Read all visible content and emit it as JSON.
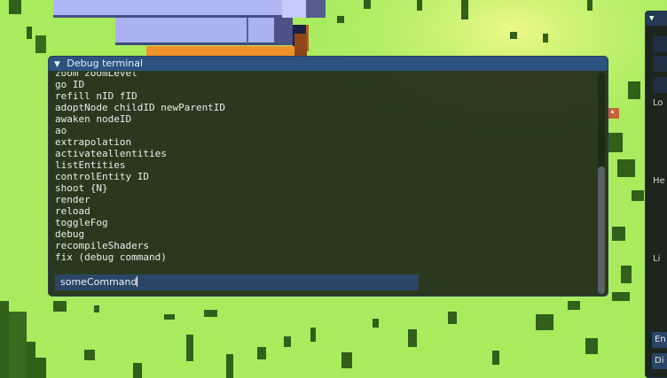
{
  "terminal": {
    "title": "Debug terminal",
    "lines": [
      "zoom zoomLevel",
      "go ID",
      "refill nID fID",
      "adoptNode childID newParentID",
      "awaken nodeID",
      "ao",
      "extrapolation",
      "activateallentities",
      "listEntities",
      "controlEntity ID",
      "shoot {N}",
      "render",
      "reload",
      "toggleFog",
      "debug",
      "recompileShaders",
      "fix (debug command)"
    ],
    "input_value": "someCommand"
  },
  "side_window": {
    "labels": [
      "Lo",
      "He",
      "Li"
    ],
    "buttons": [
      "En",
      "Di"
    ]
  },
  "colors": {
    "grass": "#a8ec5e",
    "grass_shadow": "#2f5a15",
    "title_bar": "#2c5282",
    "input_bg": "#2a4566"
  }
}
